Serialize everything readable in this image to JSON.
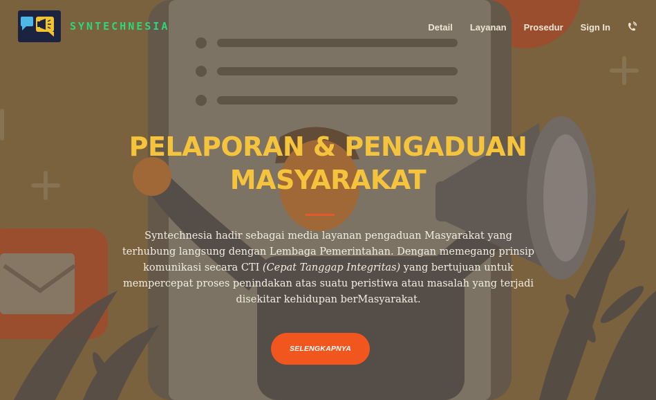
{
  "brand": {
    "name": "SYNTECHNESIA",
    "logo_icon": "megaphone-chat-icon"
  },
  "nav": {
    "items": [
      {
        "label": "Detail"
      },
      {
        "label": "Layanan"
      },
      {
        "label": "Prosedur"
      },
      {
        "label": "Sign In"
      }
    ],
    "phone_icon": "phone-ringing-icon"
  },
  "hero": {
    "title_line1": "PELAPORAN & PENGADUAN",
    "title_line2": "MASYARAKAT",
    "desc_part1": "Syntechnesia hadir sebagai media layanan pengaduan Masyarakat yang terhubung langsung dengan Lembaga Pemerintahan. Dengan memegang prinsip komunikasi secara CTI ",
    "desc_italic": "(Cepat Tanggap Integritas)",
    "desc_part2": " yang bertujuan untuk mempercepat proses penindakan atas suatu peristiwa atau masalah yang terjadi disekitar kehidupan berMasyarakat.",
    "cta_label": "SELENGKAPNYA"
  },
  "colors": {
    "title": "#f6c43c",
    "accent": "#f0561d",
    "brand": "#2fd67a",
    "overlay_bg": "#8a7048"
  }
}
